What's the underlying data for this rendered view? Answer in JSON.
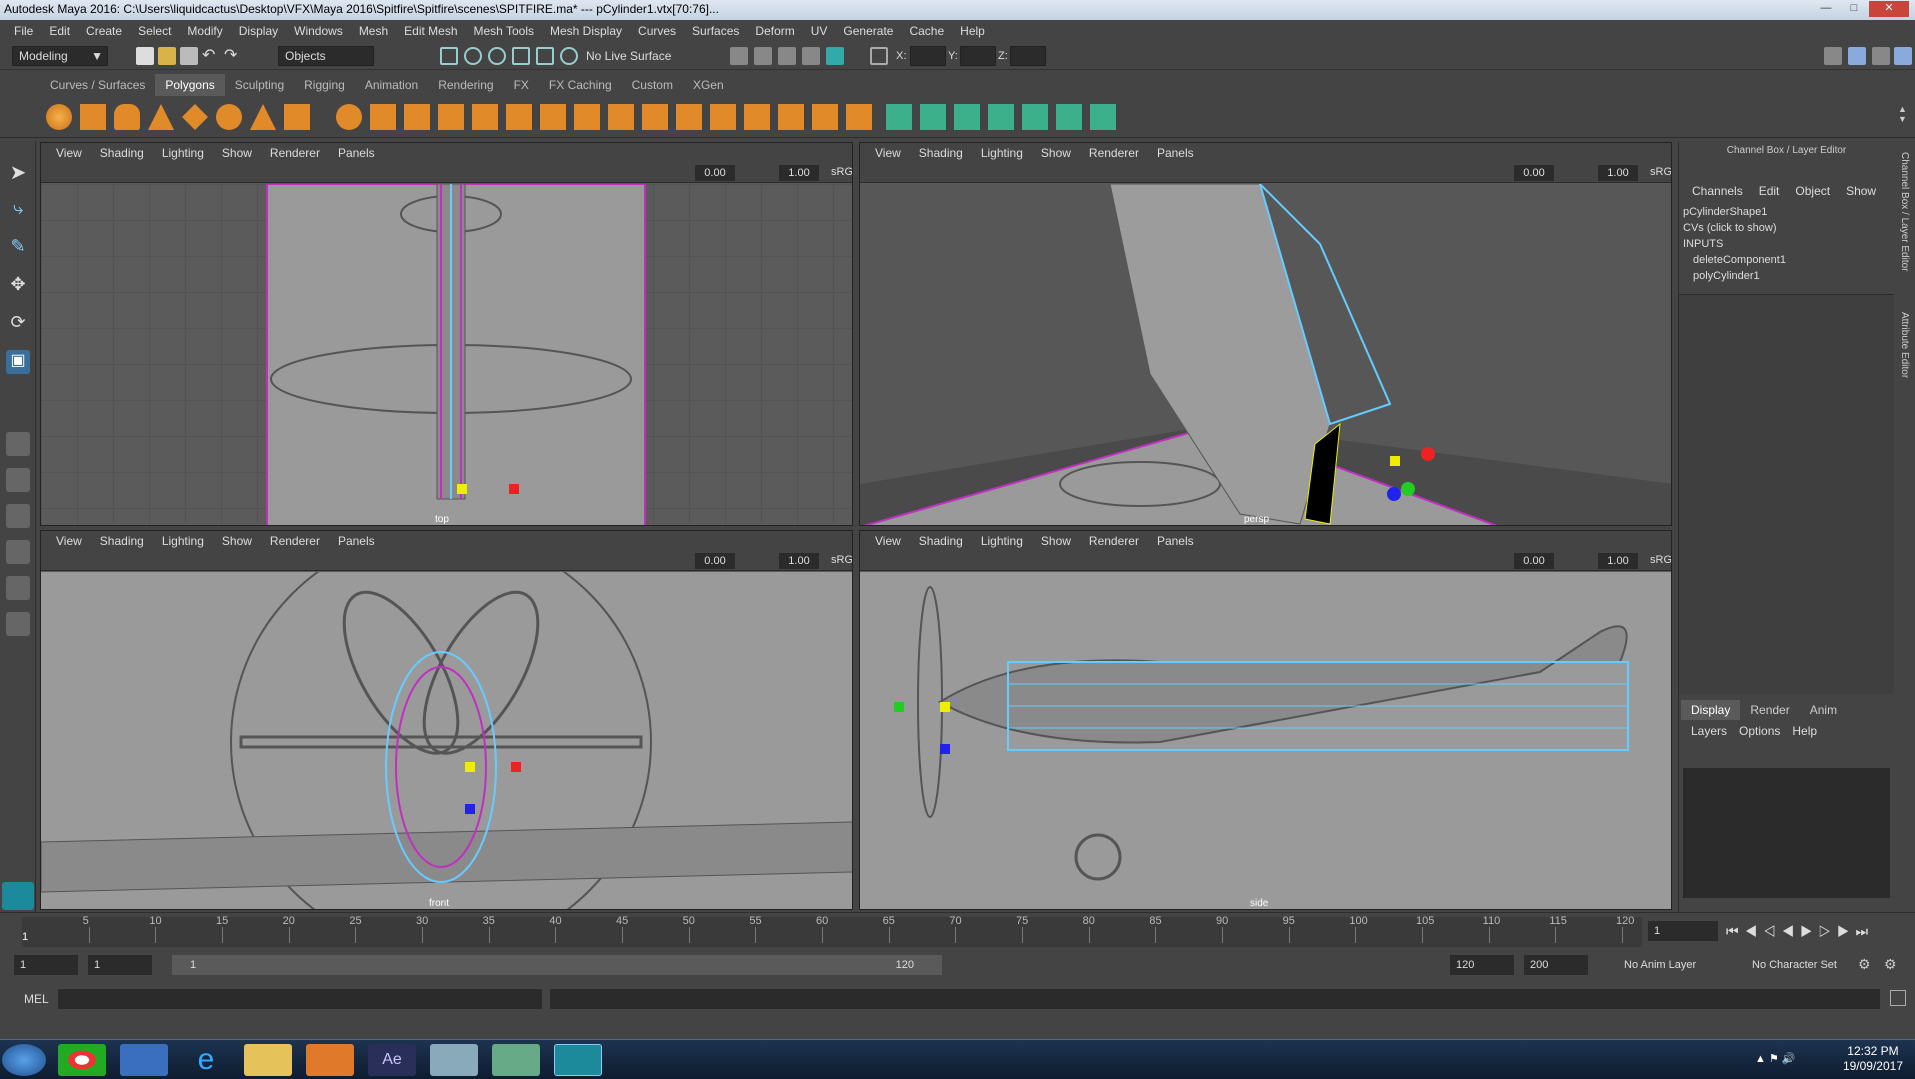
{
  "window": {
    "title": "Autodesk Maya 2016: C:\\Users\\liquidcactus\\Desktop\\VFX\\Maya 2016\\Spitfire\\Spitfire\\scenes\\SPITFIRE.ma*   ---   pCylinder1.vtx[70:76]..."
  },
  "menu": [
    "File",
    "Edit",
    "Create",
    "Select",
    "Modify",
    "Display",
    "Windows",
    "Mesh",
    "Edit Mesh",
    "Mesh Tools",
    "Mesh Display",
    "Curves",
    "Surfaces",
    "Deform",
    "UV",
    "Generate",
    "Cache",
    "Help"
  ],
  "statusline": {
    "mode": "Modeling",
    "selection_mode": "Objects",
    "live_surface": "No Live Surface",
    "x_label": "X:",
    "y_label": "Y:",
    "z_label": "Z:"
  },
  "shelf_tabs": [
    "Curves / Surfaces",
    "Polygons",
    "Sculpting",
    "Rigging",
    "Animation",
    "Rendering",
    "FX",
    "FX Caching",
    "Custom",
    "XGen"
  ],
  "viewport_menu": [
    "View",
    "Shading",
    "Lighting",
    "Show",
    "Renderer",
    "Panels"
  ],
  "viewports": [
    {
      "label": "top",
      "exposure": "0.00",
      "gamma": "1.00",
      "colorspace": "sRGB"
    },
    {
      "label": "persp",
      "exposure": "0.00",
      "gamma": "1.00",
      "colorspace": "sRGB"
    },
    {
      "label": "front",
      "exposure": "0.00",
      "gamma": "1.00",
      "colorspace": "sRGB"
    },
    {
      "label": "side",
      "exposure": "0.00",
      "gamma": "1.00",
      "colorspace": "sRGB"
    }
  ],
  "channel_box": {
    "title": "Channel Box / Layer Editor",
    "menu": [
      "Channels",
      "Edit",
      "Object",
      "Show"
    ],
    "lines": [
      "pCylinderShape1",
      "CVs (click to show)",
      "INPUTS",
      "deleteComponent1",
      "polyCylinder1"
    ],
    "layer_tabs": [
      "Display",
      "Render",
      "Anim"
    ],
    "layer_menu": [
      "Layers",
      "Options",
      "Help"
    ]
  },
  "side_tabs": [
    "Channel Box / Layer Editor",
    "Attribute Editor"
  ],
  "time_slider": {
    "ticks": [
      "5",
      "10",
      "15",
      "20",
      "25",
      "30",
      "35",
      "40",
      "45",
      "50",
      "55",
      "60",
      "65",
      "70",
      "75",
      "80",
      "85",
      "90",
      "95",
      "100",
      "105",
      "110",
      "115",
      "120"
    ],
    "current_frame": "1",
    "current_field": "1"
  },
  "range": {
    "start": "1",
    "playback_start": "1",
    "range_start": "1",
    "range_end": "120",
    "playback_end": "120",
    "end": "200",
    "anim_layer": "No Anim Layer",
    "char_set": "No Character Set"
  },
  "command_line": {
    "label": "MEL"
  },
  "taskbar": {
    "time": "12:32 PM",
    "date": "19/09/2017"
  }
}
